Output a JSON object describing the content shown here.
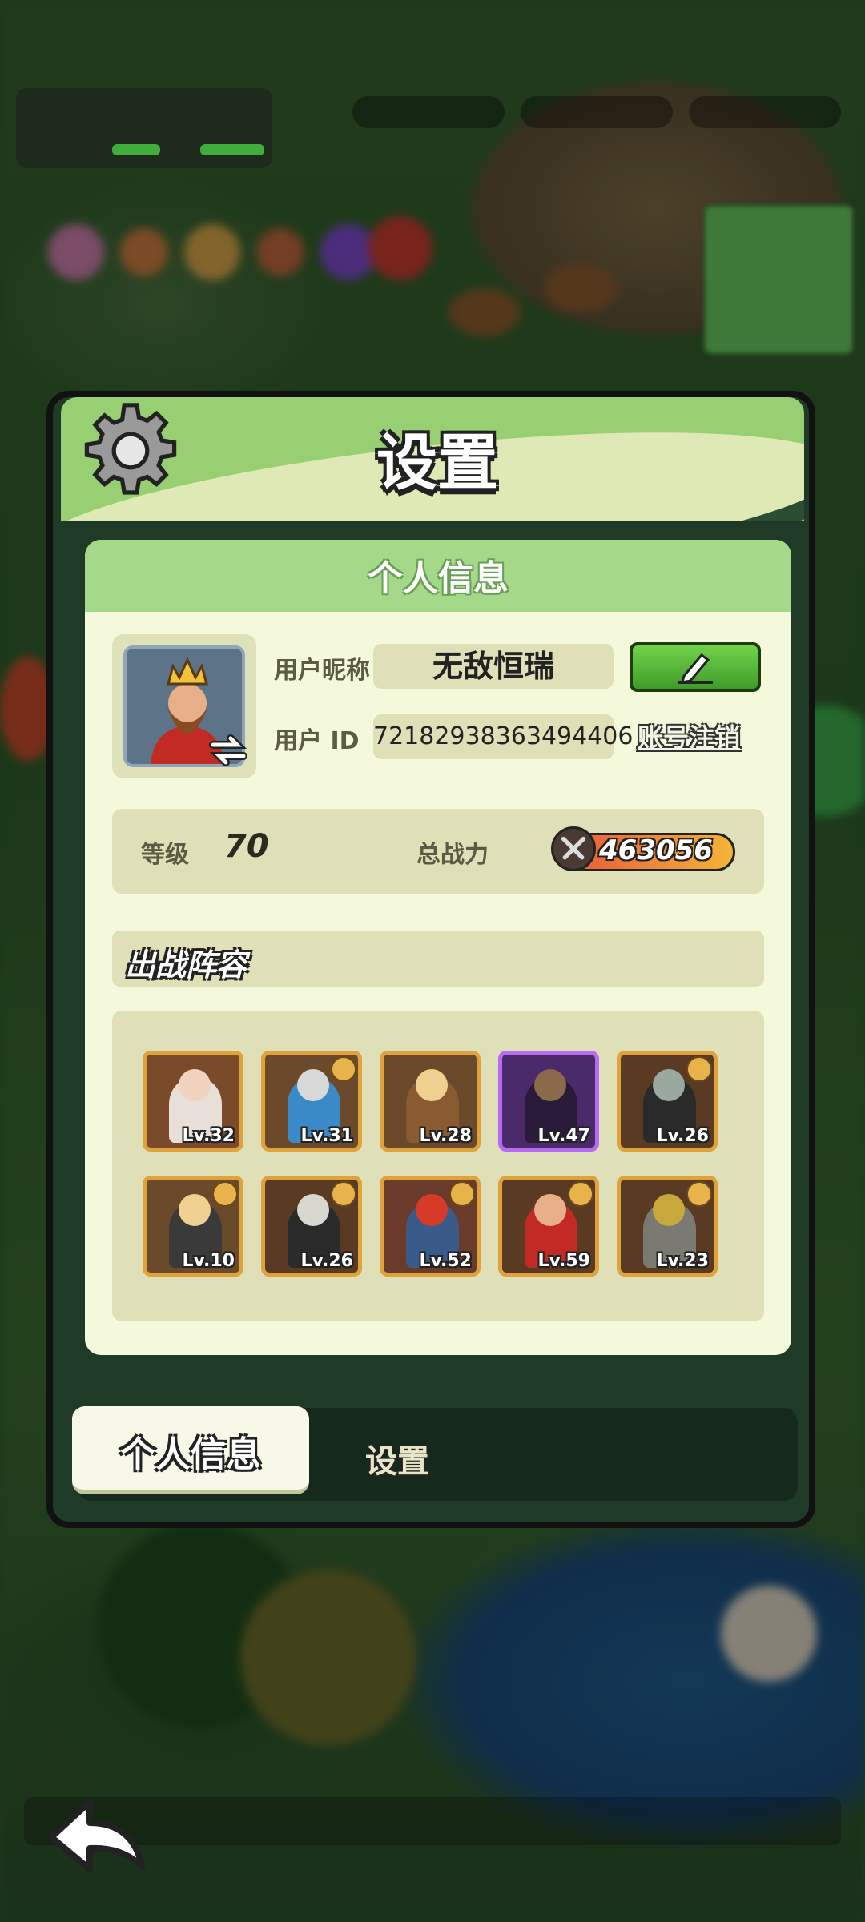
{
  "window": {
    "title": "设置"
  },
  "tabs": {
    "active_label": "个人信息",
    "settings_label": "设置"
  },
  "profile": {
    "section_title": "个人信息",
    "nickname_label": "用户昵称",
    "nickname": "无敌恒瑞",
    "id_label": "用户 ID",
    "user_id": "72182938363494406",
    "cancel_account_label": "账号注销",
    "level_label": "等级",
    "level": "70",
    "power_label": "总战力",
    "power": "463056"
  },
  "team": {
    "title": "出战阵容",
    "heroes": [
      {
        "level": "Lv.32",
        "rarity": "gold"
      },
      {
        "level": "Lv.31",
        "rarity": "gold"
      },
      {
        "level": "Lv.28",
        "rarity": "gold"
      },
      {
        "level": "Lv.47",
        "rarity": "purple"
      },
      {
        "level": "Lv.26",
        "rarity": "gold"
      },
      {
        "level": "Lv.10",
        "rarity": "gold"
      },
      {
        "level": "Lv.26",
        "rarity": "gold"
      },
      {
        "level": "Lv.52",
        "rarity": "gold"
      },
      {
        "level": "Lv.59",
        "rarity": "gold"
      },
      {
        "level": "Lv.23",
        "rarity": "gold"
      }
    ]
  },
  "icons": {
    "settings": "gear-icon",
    "edit": "pencil-icon",
    "swap": "swap-arrows-icon",
    "power": "crossed-swords-icon",
    "back": "back-arrow-icon"
  },
  "colors": {
    "accent_green": "#98cf73",
    "panel_bg": "#f5f9dc",
    "edit_button": "#5cc13a",
    "purple_rarity": "#b86bf0",
    "gold_rarity": "#e0a23a"
  }
}
